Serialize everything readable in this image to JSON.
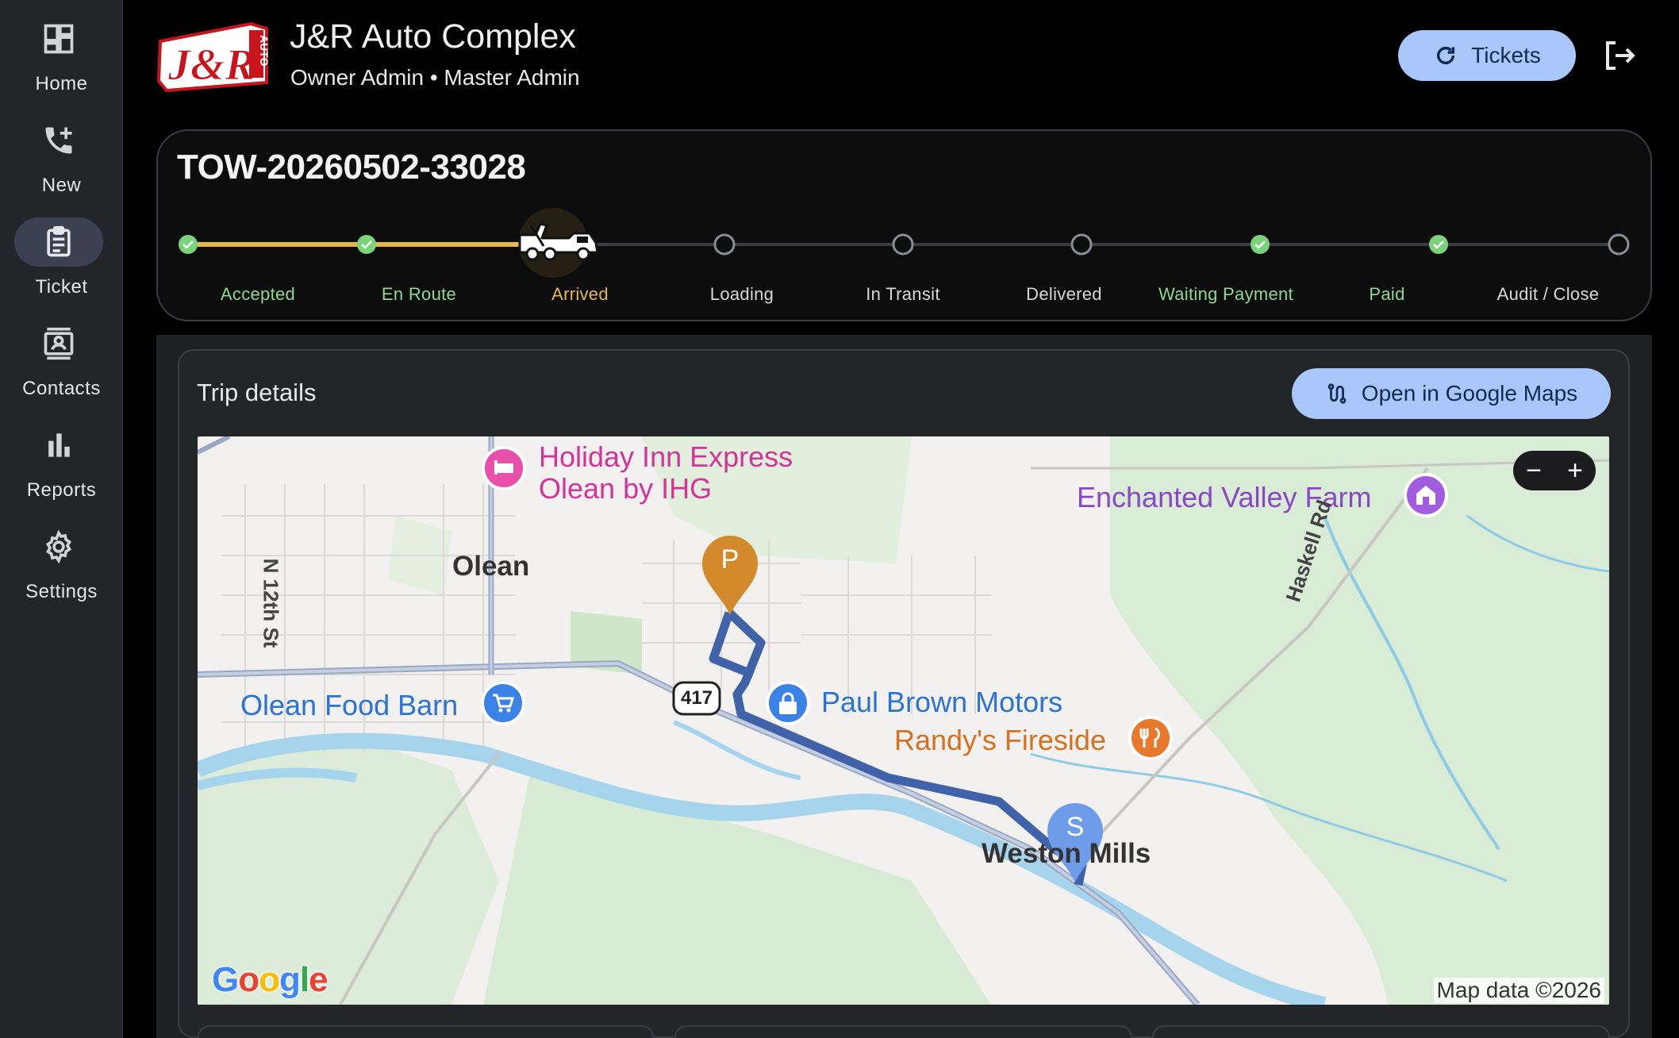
{
  "sidebar": {
    "items": [
      {
        "label": "Home",
        "icon": "dashboard-icon"
      },
      {
        "label": "New",
        "icon": "phone-add-icon"
      },
      {
        "label": "Ticket",
        "icon": "clipboard-icon",
        "active": true
      },
      {
        "label": "Contacts",
        "icon": "contacts-icon"
      },
      {
        "label": "Reports",
        "icon": "bar-chart-icon"
      },
      {
        "label": "Settings",
        "icon": "gear-icon"
      }
    ]
  },
  "header": {
    "logo_text": "J&R AUTO",
    "title": "J&R Auto Complex",
    "subtitle": "Owner Admin • Master Admin",
    "tickets_button": "Tickets",
    "accent_color": "#a9c7fa"
  },
  "ticket": {
    "id": "TOW-20260502-33028",
    "steps": [
      {
        "label": "Accepted",
        "state": "done"
      },
      {
        "label": "En Route",
        "state": "done"
      },
      {
        "label": "Arrived",
        "state": "current"
      },
      {
        "label": "Loading",
        "state": "pending"
      },
      {
        "label": "In Transit",
        "state": "pending"
      },
      {
        "label": "Delivered",
        "state": "pending"
      },
      {
        "label": "Waiting Payment",
        "state": "done"
      },
      {
        "label": "Paid",
        "state": "done"
      },
      {
        "label": "Audit / Close",
        "state": "pending"
      }
    ],
    "colors": {
      "done": "#8fd88f",
      "current": "#e6b84a",
      "pending": "#d8d8d8",
      "progress": "#e6b84a"
    }
  },
  "trip": {
    "title": "Trip details",
    "maps_button": "Open in Google Maps",
    "map": {
      "labels": {
        "holiday_inn_1": "Holiday Inn Express",
        "holiday_inn_2": "Olean by IHG",
        "olean": "Olean",
        "n12th": "N 12th St",
        "food_barn": "Olean Food Barn",
        "route_417": "417",
        "paul_brown": "Paul Brown Motors",
        "randys": "Randy's Fireside",
        "enchanted": "Enchanted Valley Farm",
        "haskell": "Haskell Rd",
        "weston": "Weston Mills",
        "pickup_marker": "P",
        "start_marker": "S"
      },
      "zoom_out": "−",
      "zoom_in": "+",
      "attribution": "Map data ©2026",
      "google_letters": [
        "G",
        "o",
        "o",
        "g",
        "l",
        "e"
      ]
    }
  }
}
